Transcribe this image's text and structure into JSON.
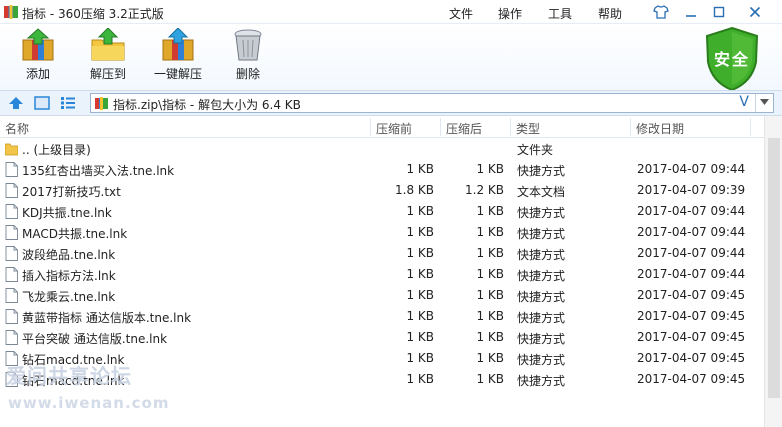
{
  "window": {
    "title": "指标 - 360压缩 3.2正式版",
    "menu": [
      "文件",
      "操作",
      "工具",
      "帮助"
    ],
    "controls": [
      "shirt-icon",
      "minimize-icon",
      "restore-icon",
      "close-icon"
    ]
  },
  "toolbar": {
    "add_label": "添加",
    "extract_label": "解压到",
    "one_click_label": "一键解压",
    "delete_label": "删除"
  },
  "security": {
    "label": "安全",
    "color": "#3fae2a"
  },
  "address": {
    "path": "指标.zip\\指标 - 解包大小为 6.4 KB",
    "v_label": "V"
  },
  "columns": {
    "name": "名称",
    "packed": "压缩前",
    "unpacked": "压缩后",
    "type": "类型",
    "modified": "修改日期"
  },
  "parent": {
    "name": ".. (上级目录)",
    "type": "文件夹"
  },
  "files": [
    {
      "name": "135红杏出墙买入法.tne.lnk",
      "before": "1 KB",
      "after": "1 KB",
      "type": "快捷方式",
      "date": "2017-04-07 09:44"
    },
    {
      "name": "2017打新技巧.txt",
      "before": "1.8 KB",
      "after": "1.2 KB",
      "type": "文本文档",
      "date": "2017-04-07 09:39"
    },
    {
      "name": "KDJ共振.tne.lnk",
      "before": "1 KB",
      "after": "1 KB",
      "type": "快捷方式",
      "date": "2017-04-07 09:44"
    },
    {
      "name": "MACD共振.tne.lnk",
      "before": "1 KB",
      "after": "1 KB",
      "type": "快捷方式",
      "date": "2017-04-07 09:44"
    },
    {
      "name": "波段绝品.tne.lnk",
      "before": "1 KB",
      "after": "1 KB",
      "type": "快捷方式",
      "date": "2017-04-07 09:44"
    },
    {
      "name": "插入指标方法.lnk",
      "before": "1 KB",
      "after": "1 KB",
      "type": "快捷方式",
      "date": "2017-04-07 09:44"
    },
    {
      "name": "飞龙乘云.tne.lnk",
      "before": "1 KB",
      "after": "1 KB",
      "type": "快捷方式",
      "date": "2017-04-07 09:45"
    },
    {
      "name": "黄蓝带指标 通达信版本.tne.lnk",
      "before": "1 KB",
      "after": "1 KB",
      "type": "快捷方式",
      "date": "2017-04-07 09:45"
    },
    {
      "name": "平台突破 通达信版.tne.lnk",
      "before": "1 KB",
      "after": "1 KB",
      "type": "快捷方式",
      "date": "2017-04-07 09:45"
    },
    {
      "name": "钻石macd.tne.lnk",
      "before": "1 KB",
      "after": "1 KB",
      "type": "快捷方式",
      "date": "2017-04-07 09:45"
    },
    {
      "name": "钻石macd.tne.lnk",
      "before": "1 KB",
      "after": "1 KB",
      "type": "快捷方式",
      "date": "2017-04-07 09:45"
    }
  ],
  "watermark": {
    "line1": "爱问共享论坛",
    "line2": "www.iwenan.com"
  }
}
